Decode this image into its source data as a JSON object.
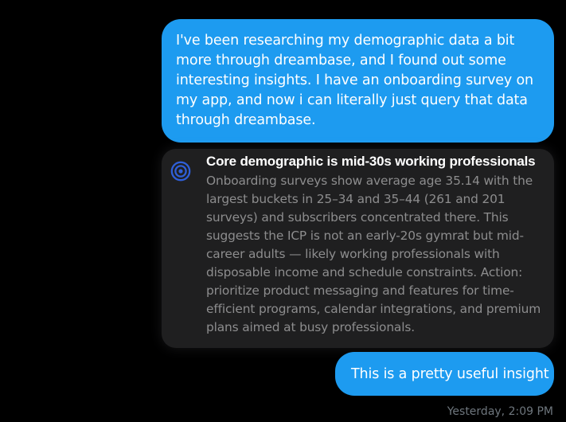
{
  "messages": [
    {
      "sender": "user",
      "text": "I've been researching my demographic data a bit more through dreambase, and I found out some interesting insights. I have an onboarding survey on my app, and now i can literally just query that data through dreambase."
    },
    {
      "sender": "user",
      "text": "This is a pretty useful insight"
    }
  ],
  "insight": {
    "icon": "target-icon",
    "title": "Core demographic is mid-30s working professionals",
    "body": "Onboarding surveys show average age 35.14 with the largest buckets in 25–34 and 35–44 (261 and 201 surveys) and subscribers concentrated there. This suggests the ICP is not an early-20s gymrat but mid-career adults — likely working professionals with disposable income and schedule constraints. Action: prioritize product messaging and features for time-efficient programs, calendar integrations, and premium plans aimed at busy professionals."
  },
  "timestamp": "Yesterday, 2:09 PM",
  "colors": {
    "background": "#000000",
    "bubble": "#1d9bf0",
    "card": "#1f1f20",
    "icon": "#2f5fd8",
    "card_body_text": "#8d8d8e",
    "timestamp": "#6e767d"
  }
}
